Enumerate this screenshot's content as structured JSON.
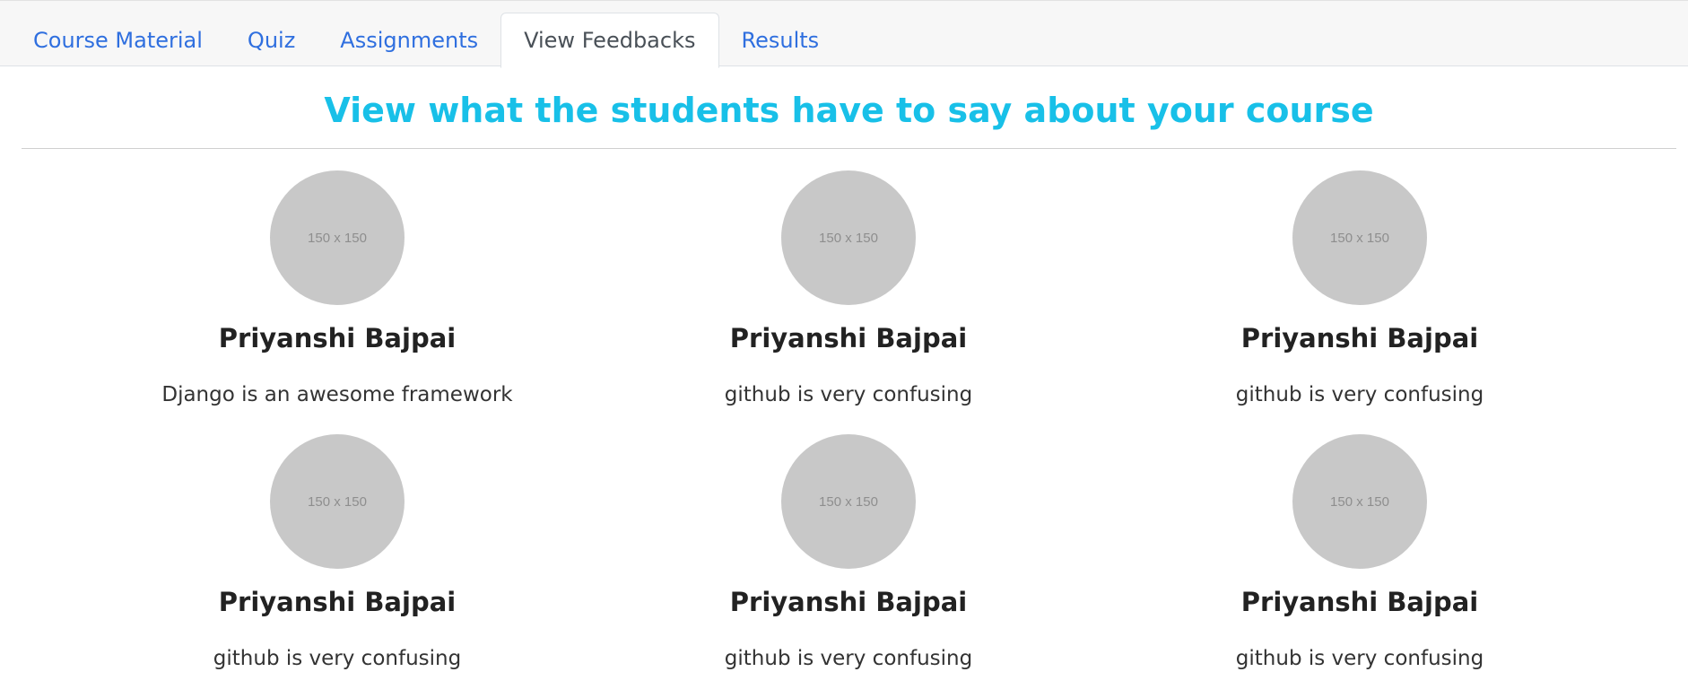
{
  "tabs": [
    {
      "label": "Course Material"
    },
    {
      "label": "Quiz"
    },
    {
      "label": "Assignments"
    },
    {
      "label": "View Feedbacks",
      "active": true
    },
    {
      "label": "Results"
    }
  ],
  "main": {
    "title": "View what the students have to say about your course"
  },
  "feedbacks": [
    {
      "avatar_text": "150 x 150",
      "name": "Priyanshi Bajpai",
      "text": "Django is an awesome framework"
    },
    {
      "avatar_text": "150 x 150",
      "name": "Priyanshi Bajpai",
      "text": "github is very confusing"
    },
    {
      "avatar_text": "150 x 150",
      "name": "Priyanshi Bajpai",
      "text": "github is very confusing"
    },
    {
      "avatar_text": "150 x 150",
      "name": "Priyanshi Bajpai",
      "text": "github is very confusing"
    },
    {
      "avatar_text": "150 x 150",
      "name": "Priyanshi Bajpai",
      "text": "github is very confusing"
    },
    {
      "avatar_text": "150 x 150",
      "name": "Priyanshi Bajpai",
      "text": "github is very confusing"
    }
  ],
  "colors": {
    "link": "#2f6fdf",
    "active_tab_text": "#495057",
    "heading": "#18c0e8",
    "placeholder_avatar": "#c8c8c8"
  }
}
